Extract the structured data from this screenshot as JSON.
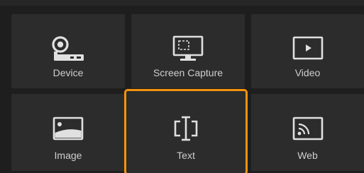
{
  "source_tiles": [
    {
      "label": "Device",
      "icon": "webcam-device-icon"
    },
    {
      "label": "Screen Capture",
      "icon": "monitor-capture-icon"
    },
    {
      "label": "Video",
      "icon": "video-play-icon"
    },
    {
      "label": "Image",
      "icon": "image-icon"
    },
    {
      "label": "Text",
      "icon": "text-cursor-icon",
      "selected": true
    },
    {
      "label": "Web",
      "icon": "web-cast-icon"
    }
  ],
  "colors": {
    "background": "#1e1e1e",
    "tile": "#2c2c2c",
    "icon": "#e0e0e0",
    "label": "#cfcfcf",
    "selection": "#f5930b"
  }
}
